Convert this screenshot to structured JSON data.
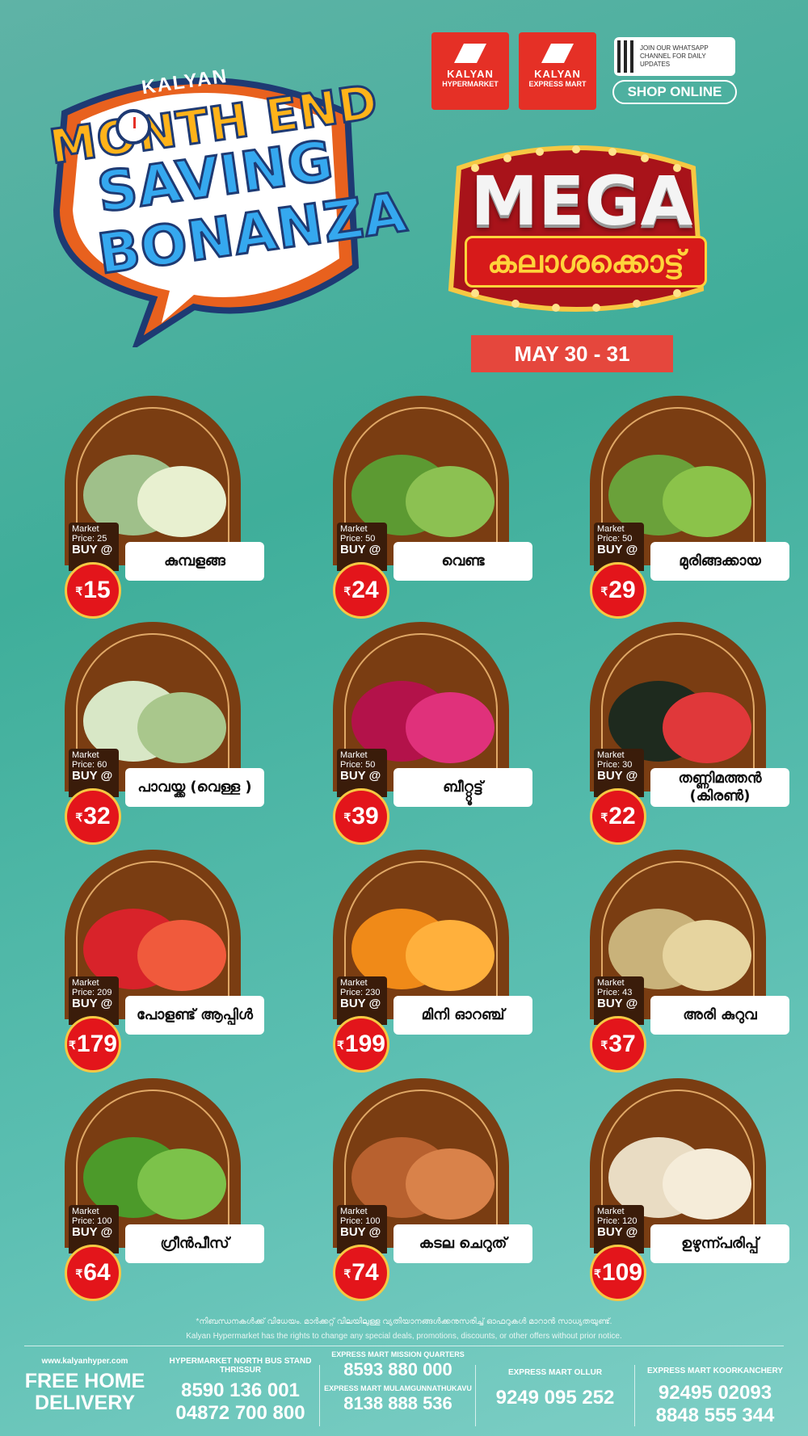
{
  "brand": {
    "kalyan": "KALYAN",
    "line1": "MONTH END",
    "line2": "SAVING",
    "line3": "BONANZA"
  },
  "logos": {
    "hyper_name": "KALYAN",
    "hyper_sub": "HYPERMARKET",
    "express_name": "KALYAN",
    "express_sub": "EXPRESS MART",
    "whatsapp_text": "JOIN OUR WHATSAPP CHANNEL FOR DAILY UPDATES",
    "shop_online": "SHOP ONLINE"
  },
  "mega": {
    "title": "MEGA",
    "subtitle": "കലാശക്കൊട്ട്"
  },
  "date": "MAY 30 - 31",
  "currency": "₹",
  "products": [
    {
      "name": "കുമ്പളങ്ങ",
      "market_price": "Market Price: 25",
      "buy": "BUY @",
      "price": "15"
    },
    {
      "name": "വെണ്ട",
      "market_price": "Market Price: 50",
      "buy": "BUY @",
      "price": "24"
    },
    {
      "name": "മുരിങ്ങക്കായ",
      "market_price": "Market Price: 50",
      "buy": "BUY @",
      "price": "29"
    },
    {
      "name": "പാവയ്ക്ക (വെള്ള )",
      "market_price": "Market Price: 60",
      "buy": "BUY @",
      "price": "32"
    },
    {
      "name": "ബീറ്റ്റൂട്ട്",
      "market_price": "Market Price: 50",
      "buy": "BUY @",
      "price": "39"
    },
    {
      "name": "തണ്ണിമത്തൻ (കിരൺ)",
      "market_price": "Market Price: 30",
      "buy": "BUY @",
      "price": "22"
    },
    {
      "name": "പോളണ്ട് ആപ്പിൾ",
      "market_price": "Market Price: 209",
      "buy": "BUY @",
      "price": "179"
    },
    {
      "name": "മിനി ഓറഞ്ച്",
      "market_price": "Market Price: 230",
      "buy": "BUY @",
      "price": "199"
    },
    {
      "name": "അരി കുറുവ",
      "market_price": "Market Price: 43",
      "buy": "BUY @",
      "price": "37"
    },
    {
      "name": "ഗ്രീൻപീസ്",
      "market_price": "Market Price: 100",
      "buy": "BUY @",
      "price": "64"
    },
    {
      "name": "കടല ചെറുത്",
      "market_price": "Market Price: 100",
      "buy": "BUY @",
      "price": "74"
    },
    {
      "name": "ഉഴുന്ന്പരിപ്പ്",
      "market_price": "Market Price: 120",
      "buy": "BUY @",
      "price": "109"
    }
  ],
  "disclaimer_line1": "*നിബന്ധനകൾക്ക് വിധേയം. മാർക്കറ്റ് വിലയിലുള്ള വ്യതിയാനങ്ങൾക്കനുസരിച്ച് ഓഫറുകൾ മാറാൻ സാധ്യതയുണ്ട്.",
  "disclaimer_line2": "Kalyan Hypermarket has the rights to change any special deals, promotions, discounts, or other offers without prior notice.",
  "footer": {
    "website": "www.kalyanhyper.com",
    "delivery1": "FREE HOME",
    "delivery2": "DELIVERY",
    "north_label": "HYPERMARKET NORTH BUS STAND",
    "north_city": "THRISSUR",
    "north_phone1": "8590 136 001",
    "north_phone2": "04872 700 800",
    "mission_label": "EXPRESS MART MISSION QUARTERS",
    "mission_phone": "8593 880 000",
    "mulam_label": "EXPRESS MART MULAMGUNNATHUKAVU",
    "mulam_phone": "8138 888 536",
    "ollur_label": "EXPRESS MART OLLUR",
    "ollur_phone": "9249 095 252",
    "koor_label": "EXPRESS MART KOORKANCHERY",
    "koor_phone1": "92495 02093",
    "koor_phone2": "8848 555 344"
  }
}
